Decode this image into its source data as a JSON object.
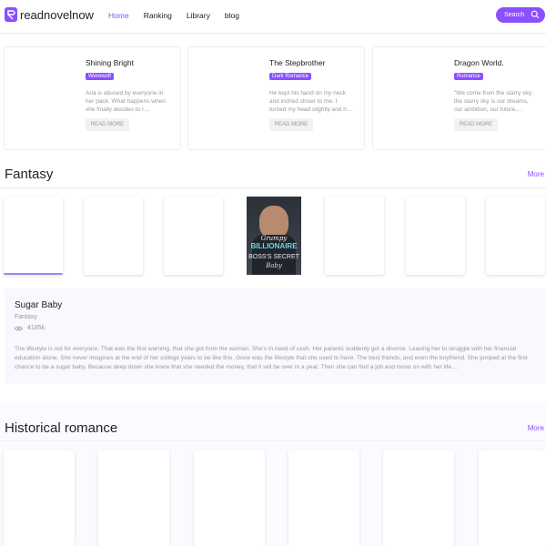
{
  "header": {
    "logo_text": "readnovelnow",
    "nav": [
      "Home",
      "Ranking",
      "Library",
      "blog"
    ],
    "search_label": "Search"
  },
  "featured": [
    {
      "title": "Shining Bright",
      "tag": "Werewolf",
      "desc": "Aria is abused by everyone in her pack. What happens when she finally decides to r…",
      "button": "READ MORE"
    },
    {
      "title": "The Stepbrother",
      "tag": "Dark Romance",
      "desc": "He kept his hand on my neck and inched closer to me. I turned my head slightly and h…",
      "button": "READ MORE"
    },
    {
      "title": "Dragon World.",
      "tag": "Romance",
      "desc": "\"We come from the starry sky; the starry sky is our dreams, our ambition, our future,…",
      "button": "READ MORE"
    }
  ],
  "fantasy": {
    "title": "Fantasy",
    "more": "More",
    "cover": {
      "line1": "Grumpy",
      "line2": "BILLIONAIRE",
      "line3": "BOSS'S SECRET",
      "line4": "Baby"
    },
    "detail": {
      "title": "Sugar Baby",
      "genre": "Fantasy",
      "views": "4185k",
      "desc": "The lifestyle is not for everyone. That was the first warning, that she got from the woman. She's in need of cash. Her parents suddenly got a divorce. Leaving her to struggle with her financial education alone. She never imagines at the end of her college years to be like this. Gone was the lifestyle that she used to have. The best friends, and even the boyfriend. She jumped at the first chance to be a sugar baby. Because deep down she knew that she needed the money, that it will be over in a year. Then she can find a job and move on with her life…"
    }
  },
  "historical": {
    "title": "Historical romance",
    "more": "More"
  }
}
